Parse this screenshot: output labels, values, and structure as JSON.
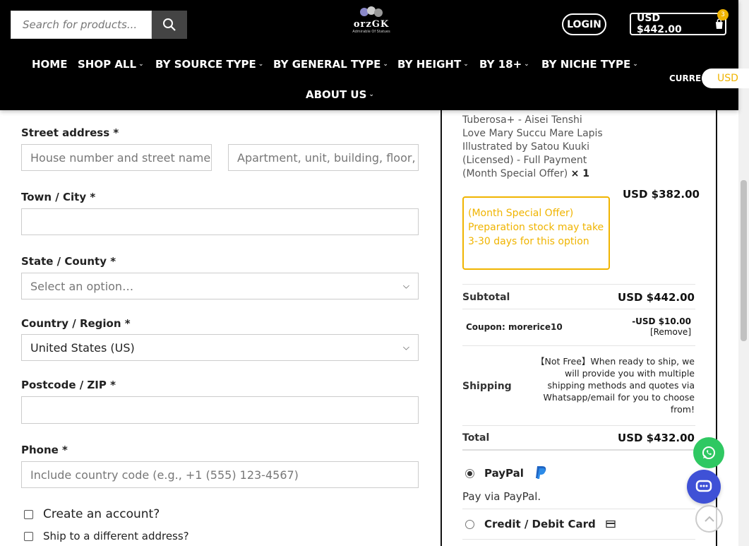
{
  "header": {
    "search_placeholder": "Search for products...",
    "logo_name": "orzGK",
    "logo_tagline": "Admirable Of Statues",
    "login_label": "LOGIN",
    "cart_total": "USD $442.00",
    "cart_count": "3",
    "currency_label": "CURRE",
    "currency_value": "USD"
  },
  "nav": {
    "items": [
      "HOME",
      "SHOP ALL",
      "BY SOURCE TYPE",
      "BY GENERAL TYPE",
      "BY HEIGHT",
      "BY 18+",
      "BY NICHE TYPE",
      "ABOUT US"
    ]
  },
  "form": {
    "street_label": "Street address *",
    "street_placeholder": "House number and street name",
    "street2_placeholder": "Apartment, unit, building, floor, etc.",
    "city_label": "Town / City *",
    "state_label": "State / County *",
    "state_value": "Select an option…",
    "country_label": "Country / Region *",
    "country_value": "United States (US)",
    "zip_label": "Postcode / ZIP *",
    "phone_label": "Phone *",
    "phone_placeholder": "Include country code (e.g., +1 (555) 123-4567)",
    "create_account": "Create an account?",
    "ship_different": "Ship to a different address?"
  },
  "order": {
    "product_name": "Tuberosa+ - Aisei Tenshi Love Mary Succu Mare Lapis Illustrated by Satou Kuuki (Licensed) - Full Payment (Month Special Offer)",
    "product_qty": "× 1",
    "product_price": "USD $382.00",
    "notice": "(Month Special Offer) Preparation stock may take 3-30 days for this option",
    "subtotal_label": "Subtotal",
    "subtotal_value": "USD $442.00",
    "coupon_label": "Coupon: morerice10",
    "coupon_value": "-USD $10.00",
    "coupon_remove": "[Remove]",
    "shipping_label": "Shipping",
    "shipping_text": "【Not Free】When ready to ship, we will provide you with multiple shipping methods and quotes via Whatsapp/email for you to choose from!",
    "total_label": "Total",
    "total_value": "USD $432.00",
    "paypal_label": "PayPal",
    "paypal_desc": "Pay via PayPal.",
    "card_label": "Credit / Debit Card"
  },
  "colors": {
    "accent": "#f0b400",
    "header_bg": "#000000",
    "whatsapp": "#2fc862",
    "chat": "#3f51d6",
    "paypal_blue": "#1f64c3"
  }
}
